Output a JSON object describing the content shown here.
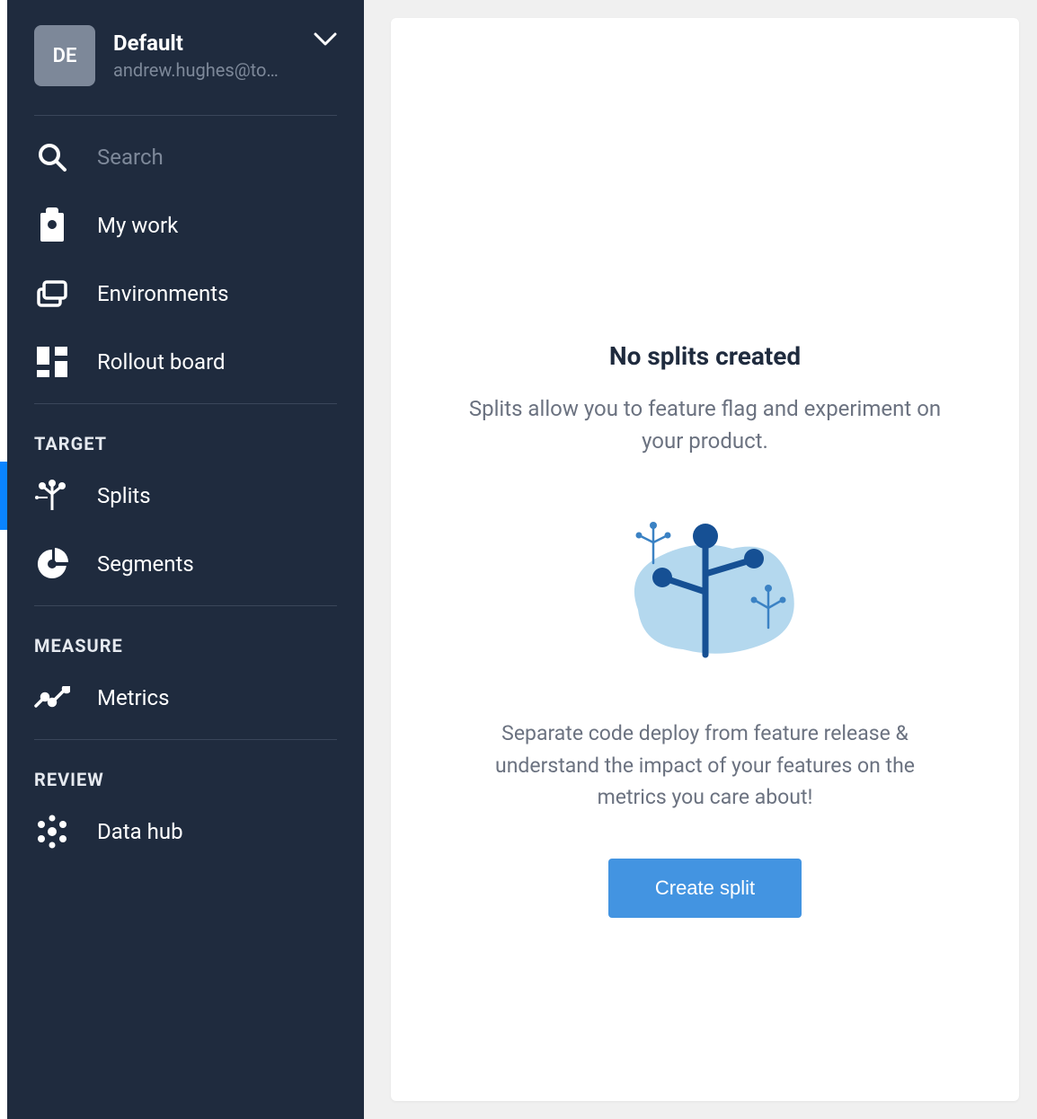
{
  "workspace": {
    "badge": "DE",
    "name": "Default",
    "email": "andrew.hughes@to…"
  },
  "nav": {
    "search": "Search",
    "mywork": "My work",
    "environments": "Environments",
    "rollout": "Rollout board"
  },
  "sections": {
    "target": {
      "header": "TARGET",
      "splits": "Splits",
      "segments": "Segments"
    },
    "measure": {
      "header": "MEASURE",
      "metrics": "Metrics"
    },
    "review": {
      "header": "REVIEW",
      "datahub": "Data hub"
    }
  },
  "empty": {
    "title": "No splits created",
    "subtitle": "Splits allow you to feature flag and experiment on your product.",
    "description": "Separate code deploy from feature release & understand the impact of your features on the metrics you care about!",
    "button": "Create split"
  }
}
